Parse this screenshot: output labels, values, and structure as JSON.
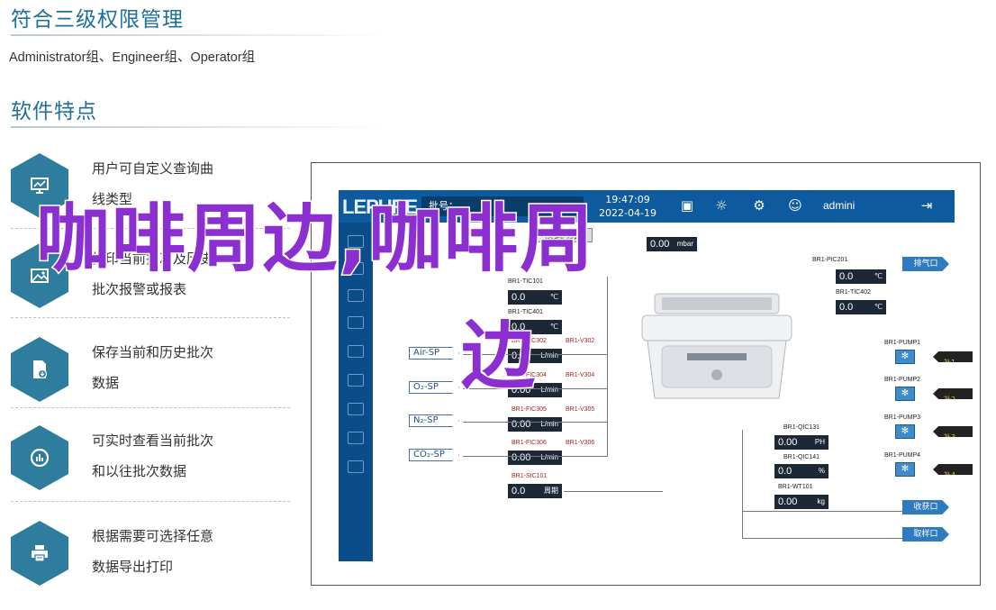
{
  "section1": {
    "title": "符合三级权限管理",
    "subtitle": "Administrator组、Engineer组、Operator组"
  },
  "section2": {
    "title": "软件特点"
  },
  "features": [
    {
      "icon": "chart-monitor-icon",
      "line1": "用户可自定义查询曲",
      "line2": "线类型"
    },
    {
      "icon": "image-icon",
      "line1": "打印当前批次及历史",
      "line2": "批次报警或报表"
    },
    {
      "icon": "file-save-icon",
      "line1": "保存当前和历史批次",
      "line2": "数据"
    },
    {
      "icon": "gauge-icon",
      "line1": "可实时查看当前批次",
      "line2": "和以往批次数据"
    },
    {
      "icon": "printer-icon",
      "line1": "根据需要可选择任意",
      "line2": "数据导出打印"
    }
  ],
  "hmi": {
    "logo": "LEPURE",
    "batch_label": "批号：",
    "time": "19:47:09",
    "date": "2022-04-19",
    "user": "admini",
    "mode_button": "模式切换",
    "sp_labels": [
      "Air-SP",
      "O₂-SP",
      "N₂-SP",
      "CO₂-SP"
    ],
    "left_values": [
      {
        "tag": "BR1-TIC101",
        "value": "0.0",
        "unit": "℃"
      },
      {
        "tag": "BR1-TIC401",
        "value": "0.0",
        "unit": "℃"
      },
      {
        "tag": "BR1-FIC302",
        "value": "0.00",
        "unit": "L/min"
      },
      {
        "tag": "BR1-FIC304",
        "value": "0.00",
        "unit": "L/min"
      },
      {
        "tag": "BR1-FIC305",
        "value": "0.00",
        "unit": "L/min"
      },
      {
        "tag": "BR1-FIC306",
        "value": "0.00",
        "unit": "L/min"
      },
      {
        "tag": "BR1-SIC101",
        "value": "0.0",
        "unit": "周期"
      }
    ],
    "valves": [
      "BR1-V302",
      "BR1-V304",
      "BR1-V305",
      "BR1-V306"
    ],
    "top_value": {
      "value": "0.00",
      "unit": "mbar"
    },
    "right_values": [
      {
        "tag": "BR1-PIC201",
        "value": "0.0",
        "unit": "℃"
      },
      {
        "tag": "BR1-TIC402",
        "value": "0.0",
        "unit": "℃"
      },
      {
        "tag": "BR1-QIC131",
        "value": "0.00",
        "unit": "PH"
      },
      {
        "tag": "BR1-QIC141",
        "value": "0.0",
        "unit": "%"
      },
      {
        "tag": "BR1-WT101",
        "value": "0.00",
        "unit": "kg"
      }
    ],
    "pumps": [
      "BR1-PUMP1",
      "BR1-PUMP2",
      "BR1-PUMP3",
      "BR1-PUMP4"
    ],
    "pump_warn": [
      "补1",
      "补2",
      "补3",
      "补4"
    ],
    "exits": [
      "排气口",
      "收获口",
      "取样口"
    ]
  },
  "overlay": {
    "line1": "咖啡周边,咖啡周",
    "line2": "边"
  }
}
